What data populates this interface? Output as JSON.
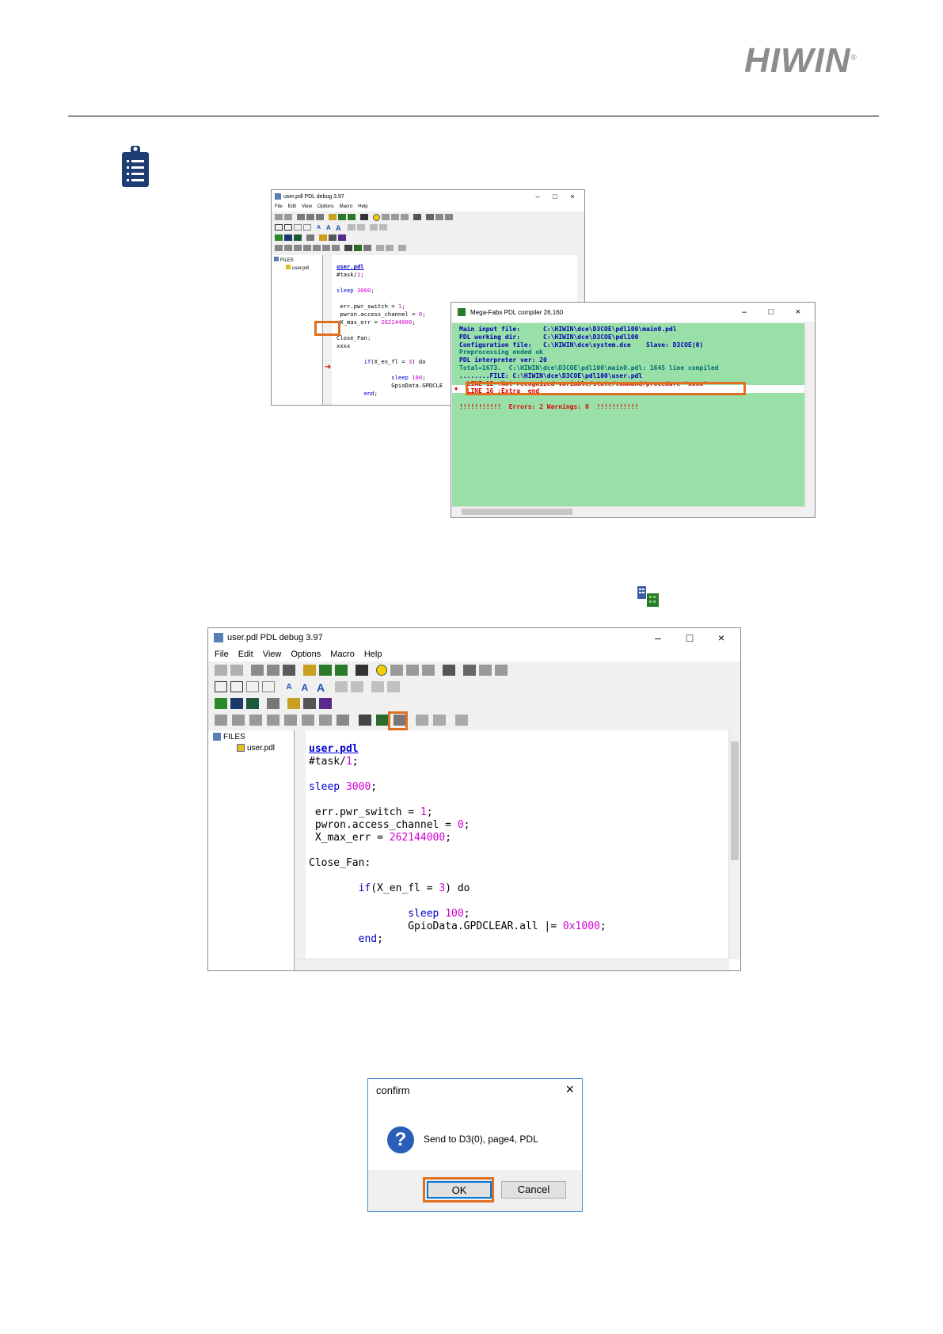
{
  "brand": {
    "logo_text": "HIWIN",
    "registered_mark": "®"
  },
  "debug_window_small": {
    "title": "user.pdl  PDL debug 3.97",
    "menu": [
      "File",
      "Edit",
      "View",
      "Options",
      "Macro",
      "Help"
    ],
    "tree_root": "FILES",
    "tree_file": "user.pdl",
    "file_header": "user.pdl",
    "highlighted_text": "xxxx"
  },
  "compiler_window": {
    "title": "Mega-Fabs PDL compiler 26.160",
    "lines": [
      {
        "text": "Main input file:      C:\\HIWIN\\dce\\D3COE\\pdl100\\main0.pdl",
        "color": "#0000b0"
      },
      {
        "text": "PDL working dir:      C:\\HIWIN\\dce\\D3COE\\pdl100",
        "color": "#0000b0"
      },
      {
        "text": "Configuration file:   C:\\HIWIN\\dce\\system.dce    Slave: D3COE(0)",
        "color": "#0000b0"
      },
      {
        "text": "Preprocessing ended ok",
        "color": "#007070"
      },
      {
        "text": "PDL interpreter ver: 20",
        "color": "#0000b0"
      },
      {
        "text": "Total=1673.  C:\\HIWIN\\dce\\D3COE\\pdl100\\main0.pdl: 1645 line compiled",
        "color": "#007070"
      },
      {
        "text": "........FILE: C:\\HIWIN\\dce\\D3COE\\pdl100\\user.pdl",
        "color": "#0000b0"
      },
      {
        "text": "  LINE 12 :Not recognized variable/state/command/procedure 'xxxx'",
        "color": "#e00000"
      },
      {
        "text": "  LINE 16 :Extra  end",
        "color": "#e00000"
      },
      {
        "text": "",
        "color": "#000000"
      },
      {
        "text": "!!!!!!!!!!!  Errors: 2 Warnings: 0  !!!!!!!!!!!",
        "color": "#e00000"
      }
    ]
  },
  "debug_window_large": {
    "title": "user.pdl  PDL debug 3.97",
    "menu": [
      "File",
      "Edit",
      "View",
      "Options",
      "Macro",
      "Help"
    ],
    "tree_root": "FILES",
    "tree_file": "user.pdl",
    "file_header": "user.pdl"
  },
  "code": {
    "task": "#task/",
    "task_num": "1",
    "semi": ";",
    "sleep_kw": "sleep",
    "sleep_val": "3000",
    "err_line": " err.pwr_switch = ",
    "err_val": "1",
    "pwron_line": " pwron.access_channel = ",
    "pwron_val": "0",
    "xmax_line": " X_max_err = ",
    "xmax_val": "262144000",
    "label": "Close_Fan:",
    "if_kw": "if",
    "if_cond": "(X_en_fl = ",
    "if_num": "3",
    "if_end": ") do",
    "sleep2_val": "100",
    "gpio_line": "GpioData.GPDCLEAR.all |= ",
    "gpio_val": "0x1000",
    "gpio_short": "GpioData.GPDCLE",
    "end_kw": "end"
  },
  "confirm_dialog": {
    "title": "confirm",
    "message": "Send to D3(0),   page4,   PDL",
    "ok_label": "OK",
    "cancel_label": "Cancel"
  },
  "colors": {
    "highlight": "#e07020",
    "compiler_bg": "#99e0a8",
    "keyword": "#0000cc",
    "number": "#d000d0"
  }
}
